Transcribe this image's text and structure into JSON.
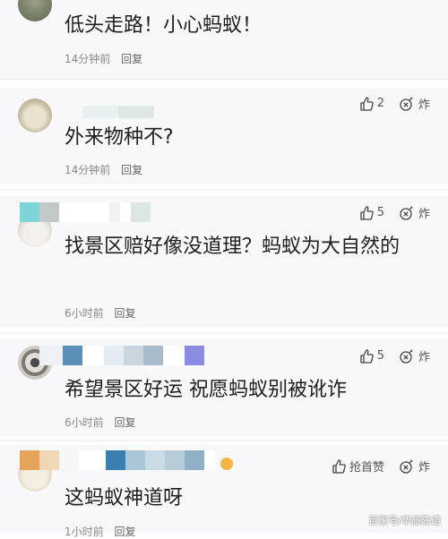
{
  "comments": [
    {
      "content": "低头走路！小心蚂蚁！",
      "time": "14分钟前",
      "reply": "回复",
      "like_count": "",
      "bomb_label": ""
    },
    {
      "content": "外来物种不?",
      "time": "14分钟前",
      "reply": "回复",
      "like_count": "2",
      "bomb_label": "炸"
    },
    {
      "content": "找景区赔好像没道理？蚂蚁为大自然的",
      "time": "6小时前",
      "reply": "回复",
      "like_count": "5",
      "bomb_label": "炸"
    },
    {
      "content": "希望景区好运 祝愿蚂蚁别被讹诈",
      "time": "6小时前",
      "reply": "回复",
      "like_count": "5",
      "bomb_label": "炸"
    },
    {
      "content": "这蚂蚁神道呀",
      "time": "1小时前",
      "reply": "回复",
      "like_count": "抢首赞",
      "bomb_label": "炸"
    }
  ],
  "watermark": "百家号/华旅陈道",
  "icons": {
    "like": "thumbs-up-icon",
    "bomb": "bomb-icon"
  },
  "colors": {
    "background": "#f8f8fa",
    "meta_text": "#888888"
  }
}
